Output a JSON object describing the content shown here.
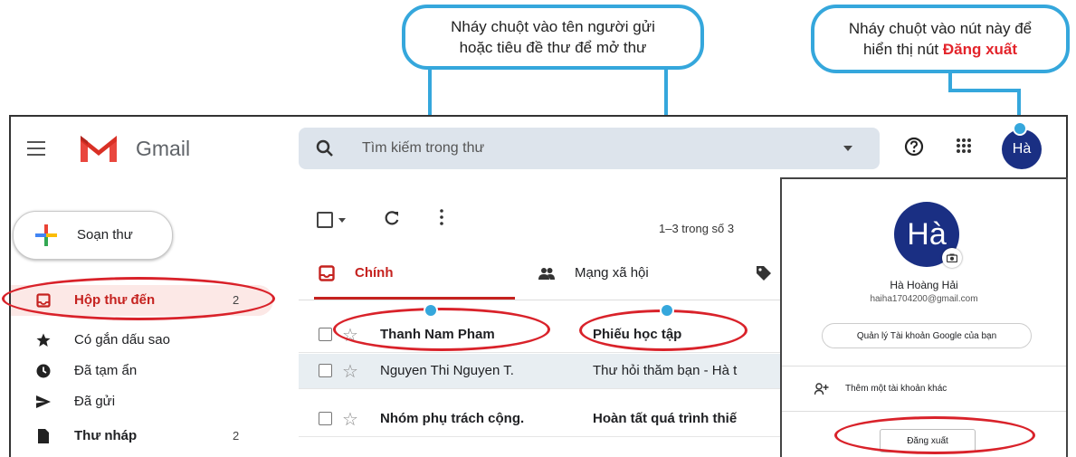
{
  "callouts": {
    "open_mail_line1": "Nháy chuột vào tên người gửi",
    "open_mail_line2": "hoặc tiêu đề thư để mở thư",
    "account_line1": "Nháy chuột vào nút này để",
    "account_line2_prefix": "hiển thị nút ",
    "account_line2_highlight": "Đăng xuất"
  },
  "header": {
    "app_name": "Gmail",
    "search_placeholder": "Tìm kiếm trong thư",
    "avatar_initials": "Hà"
  },
  "sidebar": {
    "compose_label": "Soạn thư",
    "items": [
      {
        "label": "Hộp thư đến",
        "count": "2",
        "icon": "inbox-icon"
      },
      {
        "label": "Có gắn dấu sao",
        "count": "",
        "icon": "star-icon"
      },
      {
        "label": "Đã tạm ẩn",
        "count": "",
        "icon": "clock-icon"
      },
      {
        "label": "Đã gửi",
        "count": "",
        "icon": "send-icon"
      },
      {
        "label": "Thư nháp",
        "count": "2",
        "icon": "draft-icon"
      }
    ]
  },
  "toolbar": {
    "pagination": "1–3 trong số 3"
  },
  "tabs": [
    {
      "label": "Chính",
      "icon": "inbox-icon"
    },
    {
      "label": "Mạng xã hội",
      "icon": "people-icon"
    },
    {
      "label": "",
      "icon": "tag-icon"
    }
  ],
  "emails": [
    {
      "sender": "Thanh Nam Pham",
      "subject": "Phiếu học tập",
      "unread": true
    },
    {
      "sender": "Nguyen Thi Nguyen T.",
      "subject": "Thư hỏi thăm bạn - Hà t",
      "unread": false
    },
    {
      "sender": "Nhóm phụ trách cộng.",
      "subject": "Hoàn tất quá trình thiế",
      "unread": true
    }
  ],
  "account_panel": {
    "avatar_initials": "Hà",
    "name": "Hà Hoàng Hải",
    "email": "haiha1704200@gmail.com",
    "manage_label": "Quản lý Tài khoản Google của bạn",
    "add_account_label": "Thêm một tài khoản khác",
    "signout_label": "Đăng xuất"
  },
  "colors": {
    "callout_border": "#35a7dc",
    "highlight_red": "#d9222a",
    "gmail_red": "#c5221f",
    "avatar_bg": "#1a2f83"
  }
}
